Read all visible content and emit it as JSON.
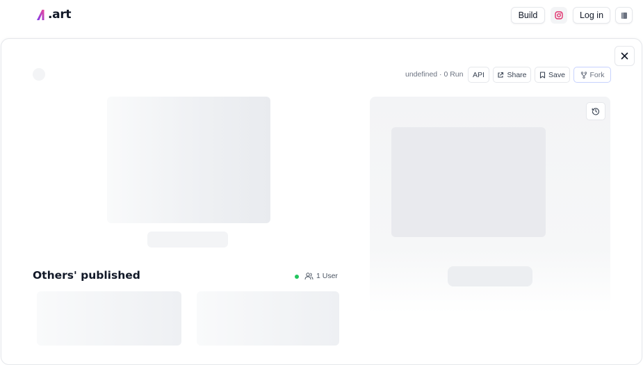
{
  "brand": {
    "logo_text": ".art"
  },
  "nav": {
    "build_label": "Build",
    "instagram_icon": "instagram-icon",
    "login_label": "Log in",
    "menu_icon": "book-icon"
  },
  "detail": {
    "meta_text": "undefined · 0 Run",
    "actions": {
      "api_label": "API",
      "share_label": "Share",
      "save_label": "Save",
      "fork_label": "Fork"
    }
  },
  "section": {
    "title": "Others' published",
    "users_label": "1 User"
  },
  "colors": {
    "brand_gradient_start": "#7c3aed",
    "brand_gradient_end": "#ec4899",
    "online": "#22c55e",
    "instagram": "#e1306c"
  }
}
